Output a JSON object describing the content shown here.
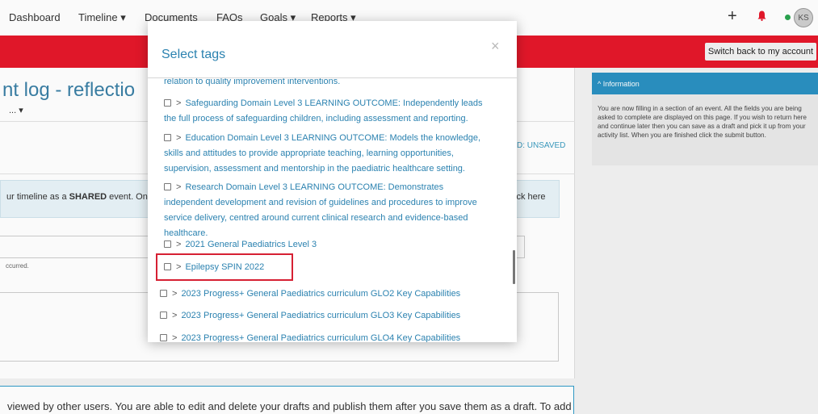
{
  "nav": {
    "items": [
      "Dashboard",
      "Timeline ▾",
      "Documents",
      "FAQs",
      "Goals ▾",
      "Reports ▾"
    ],
    "plus": "+",
    "avatar_initials": "KS"
  },
  "banner": {
    "switch_button": "Switch back to my account"
  },
  "page": {
    "title": "nt log - reflectio",
    "title_sub": "... ▾",
    "status_text": "D: UNSAVED",
    "info_left": "ur timeline as a SHARED event. Only",
    "info_right": "ick here",
    "occurred": "ccurred.",
    "bottom_text": "viewed by other users. You are able to edit and delete your drafts and publish them after you save them as a draft. To add"
  },
  "info_panel": {
    "header": "^ Information",
    "body": "You are now filling in a section of an event. All the fields you are being asked to complete are displayed on this page. If you wish to return here and continue later then you can save as a draft and pick it up from your activity list. When you are finished click the submit button."
  },
  "modal": {
    "title": "Select tags",
    "close": "×",
    "tags": [
      "relation to quality improvement interventions.",
      "Safeguarding Domain Level 3 LEARNING OUTCOME: Independently leads the full process of safeguarding children, including assessment and reporting.",
      "Education Domain Level 3 LEARNING OUTCOME: Models the knowledge, skills and attitudes to provide appropriate teaching, learning opportunities, supervision, assessment and mentorship in the paediatric healthcare setting.",
      "Research Domain Level 3 LEARNING OUTCOME: Demonstrates independent development and revision of guidelines and procedures to improve service delivery, centred around current clinical research and evidence-based healthcare.",
      "2021 General Paediatrics Level 3",
      "Epilepsy SPIN 2022",
      "2023 Progress+ General Paediatrics curriculum GLO2 Key Capabilities",
      "2023 Progress+ General Paediatrics curriculum GLO3 Key Capabilities",
      "2023 Progress+ General Paediatrics curriculum GLO4 Key Capabilities"
    ]
  }
}
